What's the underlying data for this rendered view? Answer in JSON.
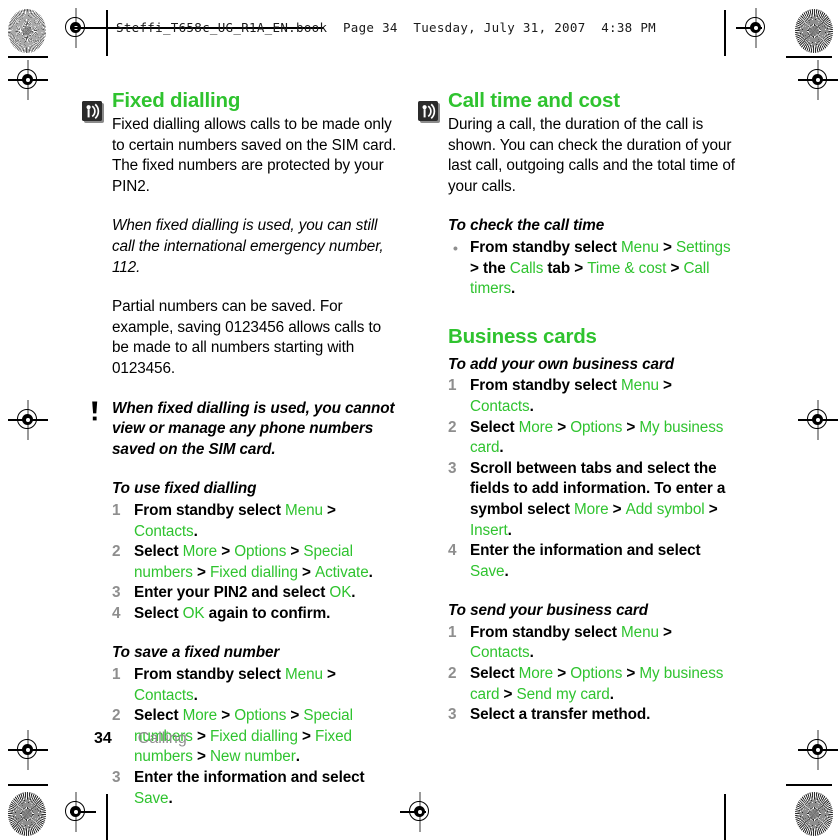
{
  "document": {
    "running_header": "Steffi_T658c_UG_R1A_EN.book  Page 34  Tuesday, July 31, 2007  4:38 PM",
    "footer": {
      "page_number": "34",
      "chapter": "Calling"
    },
    "accent_green": "#2fc32f",
    "step_number_gray": "#8e8e8e"
  },
  "left_column": {
    "heading": "Fixed dialling",
    "intro": "Fixed dialling allows calls to be made only to certain numbers saved on the SIM card. The fixed numbers are protected by your PIN2.",
    "italic_note": "When fixed dialling is used, you can still call the international emergency number, 112.",
    "partial_paragraph": "Partial numbers can be saved. For example, saving 0123456 allows calls to be made to all numbers starting with 0123456.",
    "warning": "When fixed dialling is used, you cannot view or manage any phone numbers saved on the SIM card.",
    "procedure_1": {
      "title": "To use fixed dialling",
      "steps": [
        {
          "num": "1",
          "parts": [
            {
              "t": "From standby select ",
              "k": "b"
            },
            {
              "t": "Menu",
              "k": "m"
            },
            {
              "t": " > ",
              "k": "s"
            },
            {
              "t": "Contacts",
              "k": "m"
            },
            {
              "t": ".",
              "k": "b"
            }
          ]
        },
        {
          "num": "2",
          "parts": [
            {
              "t": "Select ",
              "k": "b"
            },
            {
              "t": "More",
              "k": "m"
            },
            {
              "t": " > ",
              "k": "s"
            },
            {
              "t": "Options",
              "k": "m"
            },
            {
              "t": " > ",
              "k": "s"
            },
            {
              "t": "Special numbers",
              "k": "m"
            },
            {
              "t": " > ",
              "k": "s"
            },
            {
              "t": "Fixed dialling",
              "k": "m"
            },
            {
              "t": " > ",
              "k": "s"
            },
            {
              "t": "Activate",
              "k": "m"
            },
            {
              "t": ".",
              "k": "b"
            }
          ]
        },
        {
          "num": "3",
          "parts": [
            {
              "t": "Enter your PIN2 and select ",
              "k": "b"
            },
            {
              "t": "OK",
              "k": "m"
            },
            {
              "t": ".",
              "k": "b"
            }
          ]
        },
        {
          "num": "4",
          "parts": [
            {
              "t": "Select ",
              "k": "b"
            },
            {
              "t": "OK",
              "k": "m"
            },
            {
              "t": " again to confirm.",
              "k": "b"
            }
          ]
        }
      ]
    },
    "procedure_2": {
      "title": "To save a fixed number",
      "steps": [
        {
          "num": "1",
          "parts": [
            {
              "t": "From standby select ",
              "k": "b"
            },
            {
              "t": "Menu",
              "k": "m"
            },
            {
              "t": " > ",
              "k": "s"
            },
            {
              "t": "Contacts",
              "k": "m"
            },
            {
              "t": ".",
              "k": "b"
            }
          ]
        },
        {
          "num": "2",
          "parts": [
            {
              "t": "Select ",
              "k": "b"
            },
            {
              "t": "More",
              "k": "m"
            },
            {
              "t": " > ",
              "k": "s"
            },
            {
              "t": "Options",
              "k": "m"
            },
            {
              "t": " > ",
              "k": "s"
            },
            {
              "t": "Special numbers",
              "k": "m"
            },
            {
              "t": " > ",
              "k": "s"
            },
            {
              "t": "Fixed dialling",
              "k": "m"
            },
            {
              "t": " > ",
              "k": "s"
            },
            {
              "t": "Fixed numbers",
              "k": "m"
            },
            {
              "t": " > ",
              "k": "s"
            },
            {
              "t": "New number",
              "k": "m"
            },
            {
              "t": ".",
              "k": "b"
            }
          ]
        },
        {
          "num": "3",
          "parts": [
            {
              "t": "Enter the information and select ",
              "k": "b"
            },
            {
              "t": "Save",
              "k": "m"
            },
            {
              "t": ".",
              "k": "b"
            }
          ]
        }
      ]
    }
  },
  "right_column": {
    "heading": "Call time and cost",
    "intro": "During a call, the duration of the call is shown. You can check the duration of your last call, outgoing calls and the total time of your calls.",
    "procedure_1": {
      "title": "To check the call time",
      "steps": [
        {
          "num": "•",
          "parts": [
            {
              "t": "From standby select ",
              "k": "b"
            },
            {
              "t": "Menu",
              "k": "m"
            },
            {
              "t": " > ",
              "k": "s"
            },
            {
              "t": "Settings",
              "k": "m"
            },
            {
              "t": " > ",
              "k": "s"
            },
            {
              "t": "the ",
              "k": "b"
            },
            {
              "t": "Calls",
              "k": "m"
            },
            {
              "t": " tab",
              "k": "b"
            },
            {
              "t": " > ",
              "k": "s"
            },
            {
              "t": "Time & cost",
              "k": "m"
            },
            {
              "t": " > ",
              "k": "s"
            },
            {
              "t": "Call timers",
              "k": "m"
            },
            {
              "t": ".",
              "k": "b"
            }
          ]
        }
      ]
    },
    "heading_2": "Business cards",
    "procedure_2": {
      "title": "To add your own business card",
      "steps": [
        {
          "num": "1",
          "parts": [
            {
              "t": "From standby select ",
              "k": "b"
            },
            {
              "t": "Menu",
              "k": "m"
            },
            {
              "t": " > ",
              "k": "s"
            },
            {
              "t": "Contacts",
              "k": "m"
            },
            {
              "t": ".",
              "k": "b"
            }
          ]
        },
        {
          "num": "2",
          "parts": [
            {
              "t": "Select ",
              "k": "b"
            },
            {
              "t": "More",
              "k": "m"
            },
            {
              "t": " > ",
              "k": "s"
            },
            {
              "t": "Options",
              "k": "m"
            },
            {
              "t": " > ",
              "k": "s"
            },
            {
              "t": "My business card",
              "k": "m"
            },
            {
              "t": ".",
              "k": "b"
            }
          ]
        },
        {
          "num": "3",
          "parts": [
            {
              "t": "Scroll between tabs and select the fields to add information. To enter a symbol select ",
              "k": "b"
            },
            {
              "t": "More",
              "k": "m"
            },
            {
              "t": " > ",
              "k": "s"
            },
            {
              "t": "Add symbol",
              "k": "m"
            },
            {
              "t": " > ",
              "k": "s"
            },
            {
              "t": "Insert",
              "k": "m"
            },
            {
              "t": ".",
              "k": "b"
            }
          ]
        },
        {
          "num": "4",
          "parts": [
            {
              "t": "Enter the information and select ",
              "k": "b"
            },
            {
              "t": "Save",
              "k": "m"
            },
            {
              "t": ".",
              "k": "b"
            }
          ]
        }
      ]
    },
    "procedure_3": {
      "title": "To send your business card",
      "steps": [
        {
          "num": "1",
          "parts": [
            {
              "t": "From standby select ",
              "k": "b"
            },
            {
              "t": "Menu",
              "k": "m"
            },
            {
              "t": " > ",
              "k": "s"
            },
            {
              "t": "Contacts",
              "k": "m"
            },
            {
              "t": ".",
              "k": "b"
            }
          ]
        },
        {
          "num": "2",
          "parts": [
            {
              "t": "Select ",
              "k": "b"
            },
            {
              "t": "More",
              "k": "m"
            },
            {
              "t": " > ",
              "k": "s"
            },
            {
              "t": "Options",
              "k": "m"
            },
            {
              "t": " > ",
              "k": "s"
            },
            {
              "t": "My business card",
              "k": "m"
            },
            {
              "t": " > ",
              "k": "s"
            },
            {
              "t": "Send my card",
              "k": "m"
            },
            {
              "t": ".",
              "k": "b"
            }
          ]
        },
        {
          "num": "3",
          "parts": [
            {
              "t": "Select a transfer method.",
              "k": "b"
            }
          ]
        }
      ]
    }
  }
}
